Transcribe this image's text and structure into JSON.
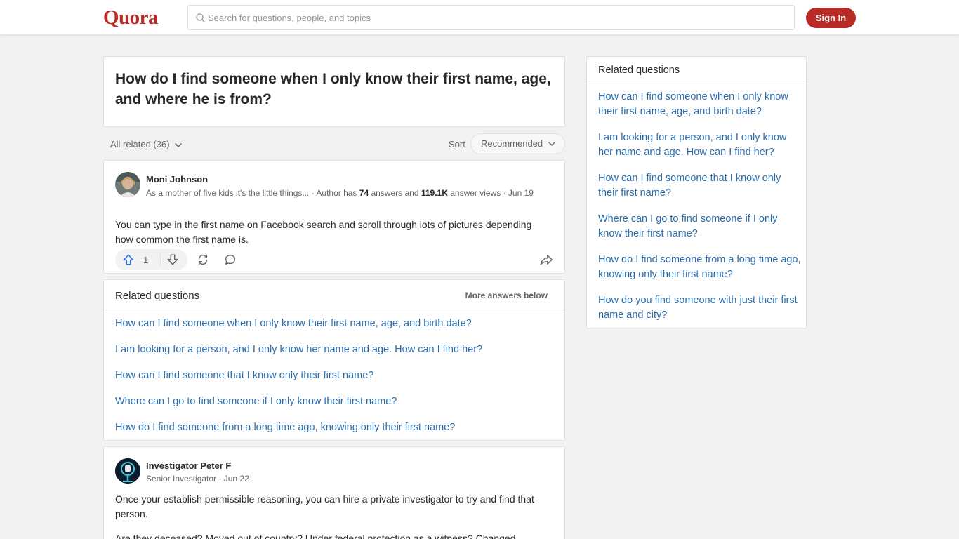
{
  "header": {
    "logo": "Quora",
    "search_placeholder": "Search for questions, people, and topics",
    "signin_label": "Sign In",
    "brand_color": "#b92b27"
  },
  "question": {
    "title": "How do I find someone when I only know their first name, age, and where he is from?"
  },
  "filters": {
    "all_related": "All related (36)",
    "sort_label": "Sort",
    "sort_value": "Recommended"
  },
  "answers": [
    {
      "author": "Moni Johnson",
      "credential": "As a mother of five kids it's the little things...",
      "meta_prefix": " · Author has ",
      "answer_count": "74",
      "meta_mid": " answers and ",
      "view_count": "119.1K",
      "meta_suffix": " answer views · ",
      "date": "Jun 19",
      "text": "You can type in the first name on Facebook search and scroll through lots of pictures depending how common the first name is.",
      "upvotes": "1"
    },
    {
      "author": "Investigator Peter F",
      "meta": "Senior Investigator · Jun 22",
      "text": "Once your establish permissible reasoning, you can hire a private investigator to try and find that person.",
      "text2": "Are they deceased? Moved out of country? Under federal protection as a witness? Changed"
    }
  ],
  "related_inline": {
    "title": "Related questions",
    "more": "More answers below",
    "items": [
      "How can I find someone when I only know their first name, age, and birth date?",
      "I am looking for a person, and I only know her name and age. How can I find her?",
      "How can I find someone that I know only their first name?",
      "Where can I go to find someone if I only know their first name?",
      "How do I find someone from a long time ago, knowing only their first name?"
    ]
  },
  "related_side": {
    "title": "Related questions",
    "items": [
      "How can I find someone when I only know their first name, age, and birth date?",
      "I am looking for a person, and I only know her name and age. How can I find her?",
      "How can I find someone that I know only their first name?",
      "Where can I go to find someone if I only know their first name?",
      "How do I find someone from a long time ago, knowing only their first name?",
      "How do you find someone with just their first name and city?"
    ]
  }
}
